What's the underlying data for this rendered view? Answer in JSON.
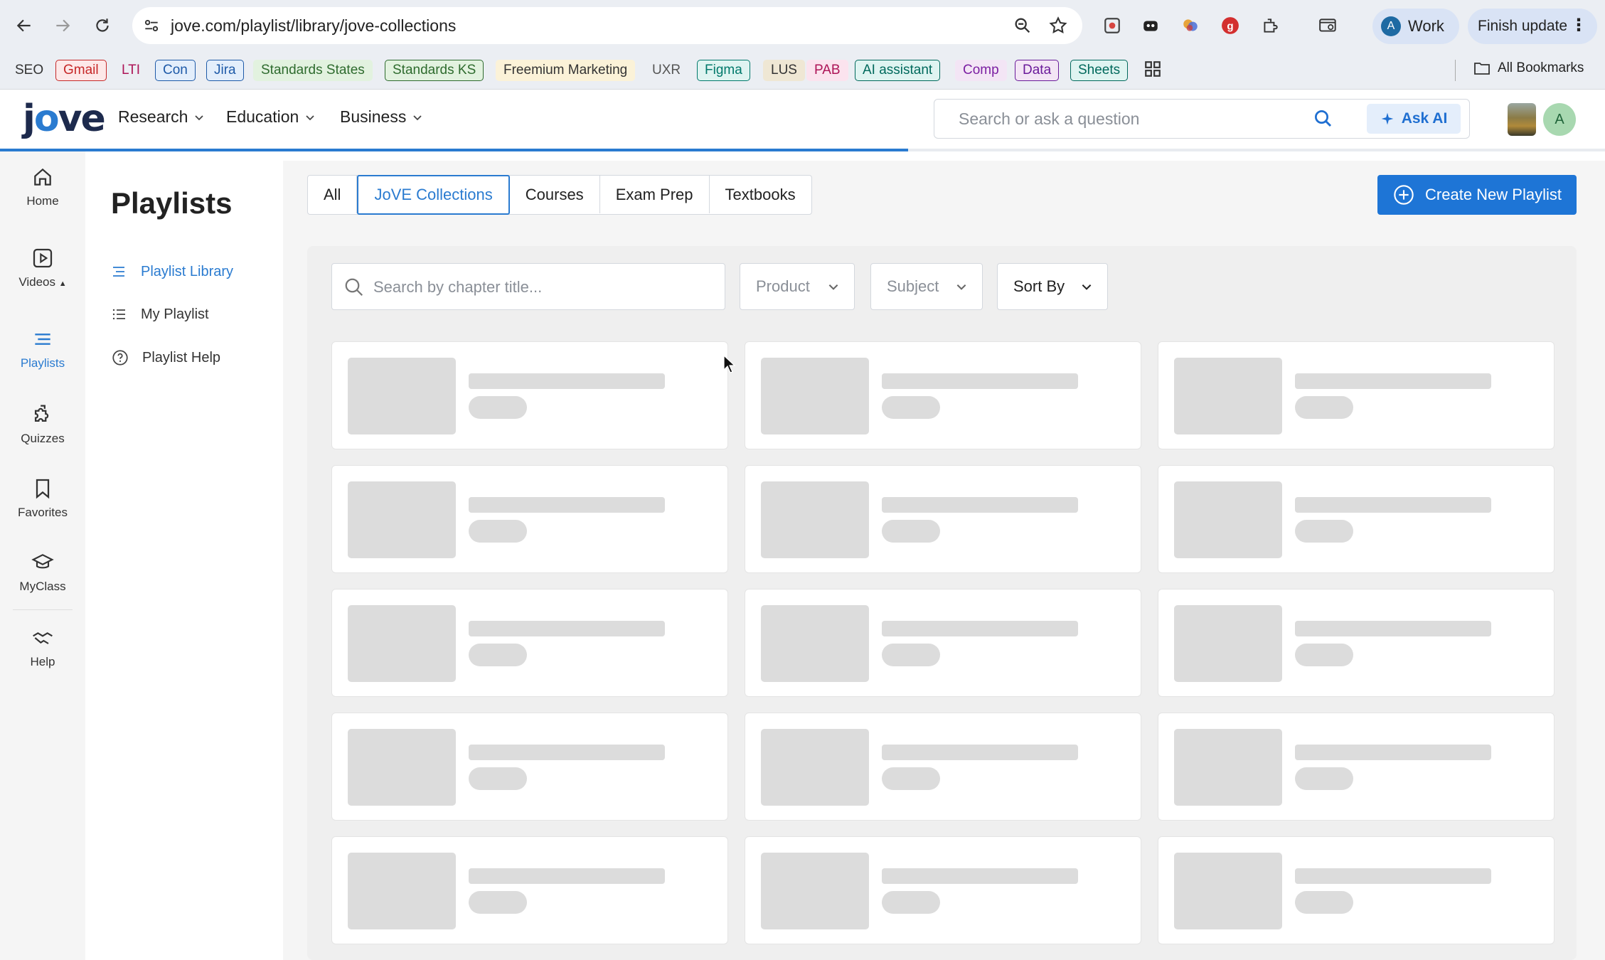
{
  "browser": {
    "url": "jove.com/playlist/library/jove-collections",
    "profile_label": "Work",
    "profile_initial": "A",
    "update_label": "Finish update"
  },
  "bookmarks": {
    "items": [
      {
        "label": "SEO",
        "color": "#333333",
        "border": "transparent",
        "bg": "transparent"
      },
      {
        "label": "Gmail",
        "color": "#c62828",
        "border": "#c62828",
        "bg": "#fde8e8"
      },
      {
        "label": "LTI",
        "color": "#ad1457",
        "border": "transparent",
        "bg": "transparent"
      },
      {
        "label": "Con",
        "color": "#1e5aa8",
        "border": "#1e5aa8",
        "bg": "#e3eefb"
      },
      {
        "label": "Jira",
        "color": "#1e5aa8",
        "border": "#1e5aa8",
        "bg": "#e3eefb"
      },
      {
        "label": "Standards States",
        "color": "#2e6b2e",
        "border": "transparent",
        "bg": "#e2f2df"
      },
      {
        "label": "Standards KS",
        "color": "#2e6b2e",
        "border": "#2e6b2e",
        "bg": "#e2f2df"
      },
      {
        "label": "Freemium Marketing",
        "color": "#333333",
        "border": "transparent",
        "bg": "#fbf2d8"
      },
      {
        "label": "UXR",
        "color": "#555555",
        "border": "transparent",
        "bg": "transparent"
      },
      {
        "label": "Figma",
        "color": "#00796b",
        "border": "#00796b",
        "bg": "#dff4f1"
      },
      {
        "label": "LUS",
        "color": "#333333",
        "border": "transparent",
        "bg": "#efe7d4"
      },
      {
        "label": "PAB",
        "color": "#ad1457",
        "border": "transparent",
        "bg": "#fbe3ee"
      },
      {
        "label": "AI assistant",
        "color": "#00695c",
        "border": "#00695c",
        "bg": "#dff4f1"
      },
      {
        "label": "Comp",
        "color": "#7b1fa2",
        "border": "transparent",
        "bg": "#f3e5f5"
      },
      {
        "label": "Data",
        "color": "#6a1b9a",
        "border": "#6a1b9a",
        "bg": "#f3e5f5"
      },
      {
        "label": "Sheets",
        "color": "#00695c",
        "border": "#00695c",
        "bg": "#dff4f1"
      }
    ],
    "all_bookmarks_label": "All Bookmarks"
  },
  "header": {
    "logo_pre": "j",
    "logo_o": "o",
    "logo_post": "ve",
    "nav": [
      "Research",
      "Education",
      "Business"
    ],
    "search_placeholder": "Search or ask a question",
    "ask_ai_label": "Ask AI",
    "user_initial": "A",
    "load_progress": 0.566
  },
  "left_nav": {
    "items": [
      {
        "label": "Home",
        "icon": "home-icon",
        "active": false
      },
      {
        "label": "Videos",
        "icon": "video-icon",
        "active": false
      },
      {
        "label": "Playlists",
        "icon": "playlist-icon",
        "active": true
      },
      {
        "label": "Quizzes",
        "icon": "puzzle-icon",
        "active": false
      },
      {
        "label": "Favorites",
        "icon": "bookmark-icon",
        "active": false
      },
      {
        "label": "MyClass",
        "icon": "graduation-cap-icon",
        "active": false
      },
      {
        "label": "Help",
        "icon": "handshake-icon",
        "active": false
      }
    ]
  },
  "sidebar": {
    "title": "Playlists",
    "items": [
      {
        "label": "Playlist Library",
        "active": true
      },
      {
        "label": "My Playlist",
        "active": false
      },
      {
        "label": "Playlist Help",
        "active": false
      }
    ]
  },
  "main": {
    "tabs": [
      {
        "label": "All",
        "active": false
      },
      {
        "label": "JoVE Collections",
        "active": true
      },
      {
        "label": "Courses",
        "active": false
      },
      {
        "label": "Exam Prep",
        "active": false
      },
      {
        "label": "Textbooks",
        "active": false
      }
    ],
    "create_label": "Create New Playlist",
    "filter_search_placeholder": "Search by chapter title...",
    "filters": {
      "product": "Product",
      "subject": "Subject",
      "sort": "Sort By"
    },
    "skeleton_rows": 5,
    "skeleton_cols": 3
  },
  "colors": {
    "accent": "#2a7bd0",
    "primary_button": "#1e75d6",
    "skeleton": "#dcdcdc"
  }
}
